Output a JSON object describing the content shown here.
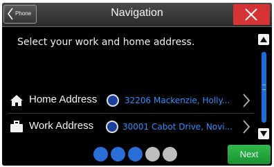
{
  "header": {
    "back_label": "Phone",
    "title": "Navigation"
  },
  "prompt": "Select your work and home address.",
  "rows": [
    {
      "label": "Home Address",
      "address": "32206 Mackenzie, Holly...",
      "icon": "home-icon"
    },
    {
      "label": "Work Address",
      "address": "30001 Cabot Drive, Novi...",
      "icon": "briefcase-icon"
    }
  ],
  "pagination": {
    "total": 5,
    "current": 3
  },
  "next_label": "Next",
  "colors": {
    "close": "#d63434",
    "accent": "#2a6fd8",
    "address_text": "#2f8fff",
    "next": "#2fbd4a"
  }
}
